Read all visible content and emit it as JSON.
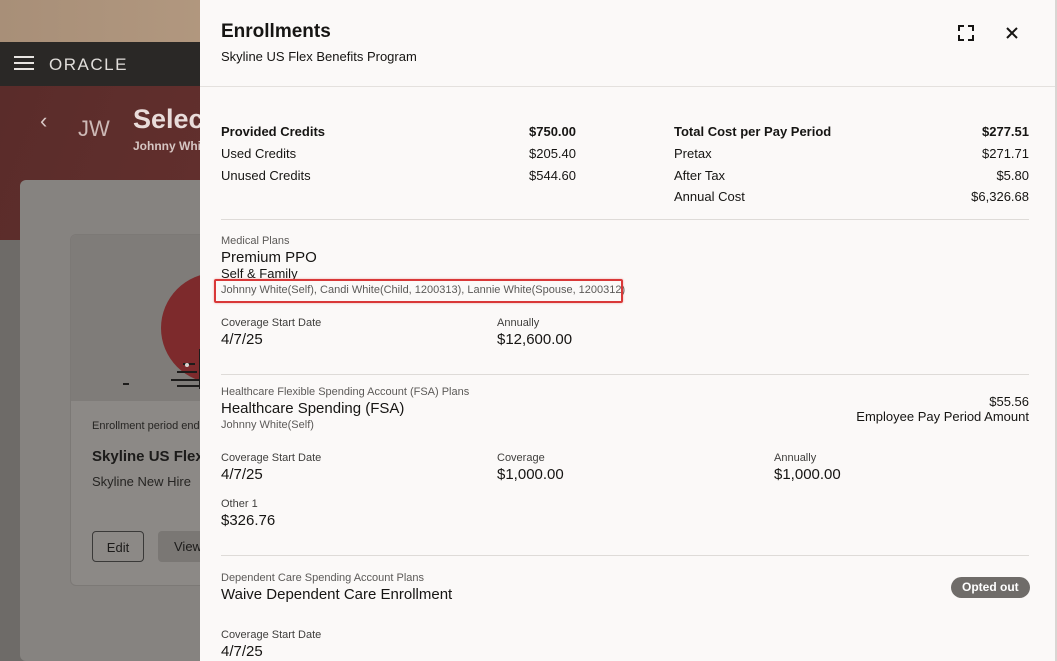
{
  "background": {
    "brand": "ORACLE",
    "initials": "JW",
    "page_title": "Select",
    "page_subtitle": "Johnny Whi",
    "card": {
      "enrollment_text": "Enrollment period end",
      "title": "Skyline US Flex",
      "subtitle": "Skyline New Hire",
      "edit_label": "Edit",
      "view_label": "View"
    }
  },
  "drawer": {
    "title": "Enrollments",
    "subtitle": "Skyline US Flex Benefits Program",
    "icons": {
      "expand": "expand-icon",
      "close": "close-icon"
    }
  },
  "credits": {
    "provided": {
      "label": "Provided Credits",
      "value": "$750.00"
    },
    "used": {
      "label": "Used Credits",
      "value": "$205.40"
    },
    "unused": {
      "label": "Unused Credits",
      "value": "$544.60"
    }
  },
  "cost": {
    "total": {
      "label": "Total Cost per Pay Period",
      "value": "$277.51"
    },
    "pretax": {
      "label": "Pretax",
      "value": "$271.71"
    },
    "aftertax": {
      "label": "After Tax",
      "value": "$5.80"
    },
    "annual": {
      "label": "Annual Cost",
      "value": "$6,326.68"
    }
  },
  "medical": {
    "category": "Medical Plans",
    "name": "Premium PPO",
    "option": "Self & Family",
    "participants": "Johnny White(Self), Candi White(Child, 1200313), Lannie White(Spouse, 1200312)",
    "start_label": "Coverage Start Date",
    "start_value": "4/7/25",
    "annual_label": "Annually",
    "annual_value": "$12,600.00"
  },
  "fsa": {
    "category": "Healthcare Flexible Spending Account (FSA) Plans",
    "name": "Healthcare Spending (FSA)",
    "participants": "Johnny White(Self)",
    "pay_amount": "$55.56",
    "pay_label": "Employee Pay Period Amount",
    "start_label": "Coverage Start Date",
    "start_value": "4/7/25",
    "coverage_label": "Coverage",
    "coverage_value": "$1,000.00",
    "annual_label": "Annually",
    "annual_value": "$1,000.00",
    "other_label": "Other 1",
    "other_value": "$326.76"
  },
  "dependent": {
    "category": "Dependent Care Spending Account Plans",
    "name": "Waive Dependent Care Enrollment",
    "badge": "Opted out",
    "start_label": "Coverage Start Date",
    "start_value": "4/7/25"
  },
  "colors": {
    "highlight": "#d93838",
    "badge_bg": "#6f6c69",
    "drawer_bg": "#fbf9f8"
  }
}
